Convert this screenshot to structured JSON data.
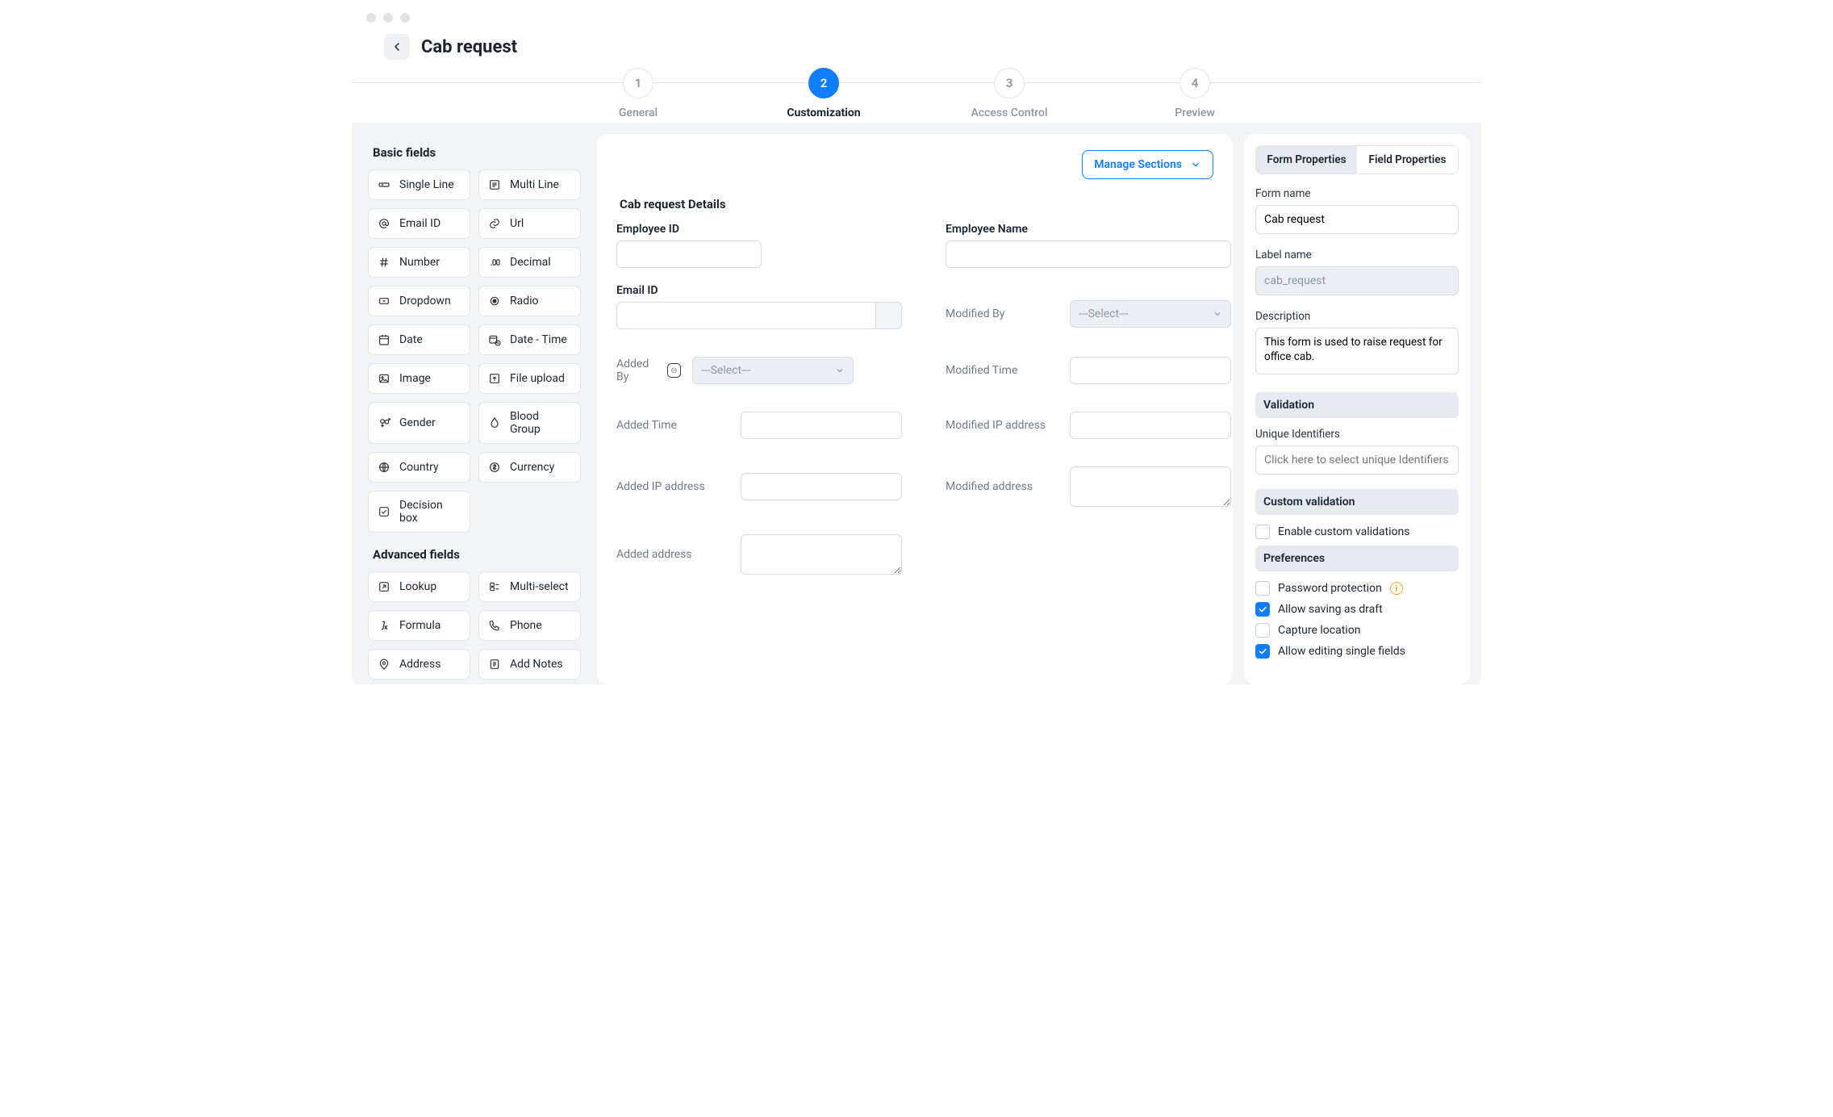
{
  "header": {
    "title": "Cab request"
  },
  "steps": [
    {
      "num": "1",
      "label": "General",
      "active": false
    },
    {
      "num": "2",
      "label": "Customization",
      "active": true
    },
    {
      "num": "3",
      "label": "Access Control",
      "active": false
    },
    {
      "num": "4",
      "label": "Preview",
      "active": false
    }
  ],
  "sidebar": {
    "basic_title": "Basic fields",
    "advanced_title": "Advanced fields",
    "basic": [
      {
        "name": "single-line",
        "label": "Single Line",
        "icon": "single-line-icon"
      },
      {
        "name": "multi-line",
        "label": "Multi Line",
        "icon": "multi-line-icon"
      },
      {
        "name": "email-id",
        "label": "Email ID",
        "icon": "at-icon"
      },
      {
        "name": "url",
        "label": "Url",
        "icon": "link-icon"
      },
      {
        "name": "number",
        "label": "Number",
        "icon": "hash-icon"
      },
      {
        "name": "decimal",
        "label": "Decimal",
        "icon": "decimal-icon"
      },
      {
        "name": "dropdown",
        "label": "Dropdown",
        "icon": "dropdown-icon"
      },
      {
        "name": "radio",
        "label": "Radio",
        "icon": "radio-icon"
      },
      {
        "name": "date",
        "label": "Date",
        "icon": "calendar-icon"
      },
      {
        "name": "date-time",
        "label": "Date - Time",
        "icon": "calendar-clock-icon"
      },
      {
        "name": "image",
        "label": "Image",
        "icon": "image-icon"
      },
      {
        "name": "file-upload",
        "label": "File upload",
        "icon": "upload-icon"
      },
      {
        "name": "gender",
        "label": "Gender",
        "icon": "gender-icon"
      },
      {
        "name": "blood-group",
        "label": "Blood Group",
        "icon": "drop-icon"
      },
      {
        "name": "country",
        "label": "Country",
        "icon": "globe-icon"
      },
      {
        "name": "currency",
        "label": "Currency",
        "icon": "currency-icon"
      },
      {
        "name": "decision-box",
        "label": "Decision box",
        "icon": "check-square-icon"
      }
    ],
    "advanced": [
      {
        "name": "lookup",
        "label": "Lookup",
        "icon": "lookup-icon"
      },
      {
        "name": "multi-select",
        "label": "Multi-select",
        "icon": "multiselect-icon"
      },
      {
        "name": "formula",
        "label": "Formula",
        "icon": "formula-icon"
      },
      {
        "name": "phone",
        "label": "Phone",
        "icon": "phone-icon"
      },
      {
        "name": "address",
        "label": "Address",
        "icon": "pin-icon"
      },
      {
        "name": "add-notes",
        "label": "Add Notes",
        "icon": "notes-icon"
      }
    ]
  },
  "canvas": {
    "manage_sections": "Manage Sections",
    "section_title": "Cab request Details",
    "select_placeholder": "---Select---",
    "fields": {
      "employee_id": "Employee ID",
      "employee_name": "Employee Name",
      "email_id": "Email ID",
      "modified_by": "Modified By",
      "added_by": "Added By",
      "modified_time": "Modified Time",
      "added_time": "Added Time",
      "modified_ip": "Modified IP address",
      "added_ip": "Added IP address",
      "modified_address": "Modified address",
      "added_address": "Added address"
    }
  },
  "props": {
    "tabs": {
      "form": "Form Properties",
      "field": "Field Properties"
    },
    "form_name_label": "Form name",
    "form_name_value": "Cab request",
    "label_name_label": "Label name",
    "label_name_value": "cab_request",
    "description_label": "Description",
    "description_value": "This form is used to raise request for office cab.",
    "validation_section": "Validation",
    "unique_label": "Unique Identifiers",
    "unique_placeholder": "Click here to select unique Identifiers",
    "custom_validation_section": "Custom validation",
    "enable_custom_validations": "Enable custom validations",
    "preferences_section": "Preferences",
    "prefs": {
      "password_protection": "Password protection",
      "allow_draft": "Allow saving as draft",
      "capture_location": "Capture location",
      "allow_edit_single": "Allow editing single fields"
    },
    "checked": {
      "allow_draft": true,
      "allow_edit_single": true
    }
  }
}
